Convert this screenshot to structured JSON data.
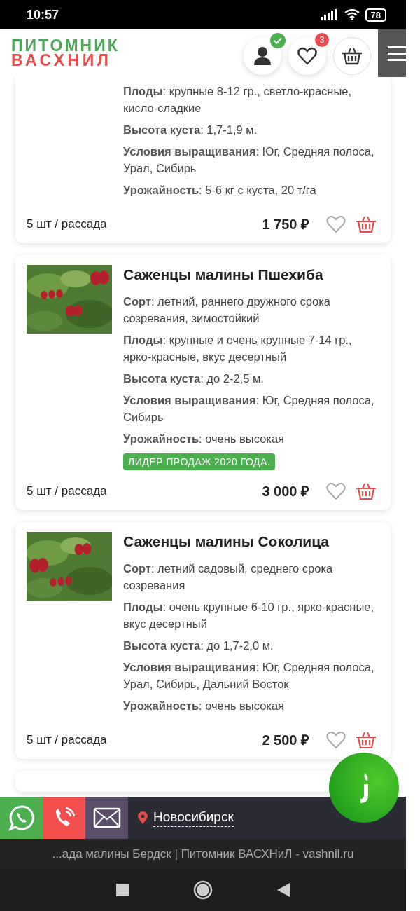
{
  "status_bar": {
    "time": "10:57",
    "battery": "78"
  },
  "header": {
    "logo_top": "ПИТОМНИК",
    "logo_bottom": "ВАСХНИЛ",
    "account_verified": true,
    "favorites_count": "3"
  },
  "products": [
    {
      "specs": [
        "**Плоды**: крупные 8-12 гр., светло-красные, кисло-сладкие",
        "**Высота куста**: 1,7-1,9 м.",
        "**Условия выращивания**: Юг, Средняя полоса, Урал, Сибирь",
        "**Урожайность**: 5-6 кг с куста, 20 т/га"
      ],
      "quantity": "5 шт / рассада",
      "price": "1 750 ₽",
      "favorite": false
    },
    {
      "title": "Саженцы малины Пшехиба",
      "specs": [
        "**Сорт**: летний, раннего дружного срока созревания, зимостойкий",
        "**Плоды**: крупные и очень крупные 7-14 гр., ярко-красные, вкус десертный",
        "**Высота куста**: до 2-2,5 м.",
        "**Условия выращивания**: Юг, Средняя полоса, Сибирь",
        "**Урожайность**: очень высокая"
      ],
      "badge": "ЛИДЕР ПРОДАЖ 2020 ГОДА.",
      "quantity": "5 шт / рассада",
      "price": "3 000 ₽",
      "favorite": false
    },
    {
      "title": "Саженцы малины Соколица",
      "specs": [
        "**Сорт**: летний садовый, среднего срока созревания",
        "**Плоды**: очень крупные 6-10 гр., ярко-красные, вкус десертный",
        "**Высота куста**: до 1,7-2,0 м.",
        "**Условия выращивания**: Юг, Средняя полоса, Урал, Сибирь, Дальний Восток",
        "**Урожайность**: очень высокая"
      ],
      "quantity": "5 шт / рассада",
      "price": "2 500 ₽",
      "favorite": false
    }
  ],
  "contact_bar": {
    "city": "Новосибирск"
  },
  "browser_title": "...ада малины Бердск | Питомник ВАСХНиЛ - vashnil.ru"
}
